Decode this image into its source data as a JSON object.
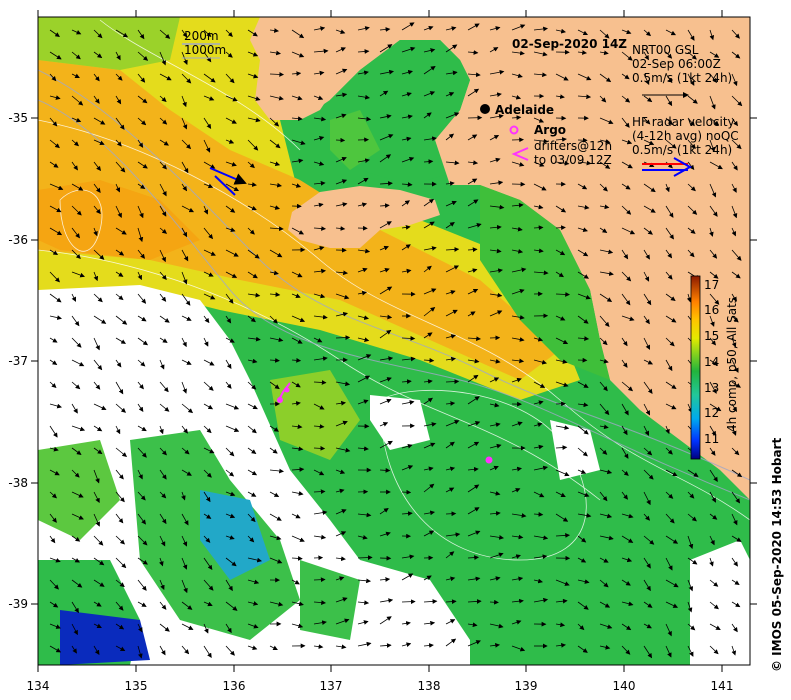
{
  "map": {
    "title": "02-Sep-2020 14Z",
    "city": "Adelaide",
    "legend_argo": "Argo",
    "legend_drifters_line1": "drifters@12h",
    "legend_drifters_line2": "to 03/09 12Z",
    "isobath_200": "200m",
    "isobath_1000": "1000m",
    "gsl_line1": "NRT00 GSL",
    "gsl_line2": "02-Sep 06:00Z",
    "gsl_line3": "0.5m/s (1kt 24h)",
    "hf_line1": "HF radar velocity",
    "hf_line2": "(4-12h avg) noQC",
    "hf_line3": "0.5m/s (1kt 24h)",
    "colorbar_label": "4h comp, p50, All Sats",
    "colorbar_ticks": [
      "11",
      "12",
      "13",
      "14",
      "15",
      "16",
      "17"
    ],
    "credit": "© IMOS 05-Sep-2020 14:53 Hobart",
    "x_ticks": [
      "134",
      "135",
      "136",
      "137",
      "138",
      "139",
      "140",
      "141"
    ],
    "y_ticks": [
      "-35",
      "-36",
      "-37",
      "-38",
      "-39"
    ],
    "colors": {
      "land": "#f7c08f",
      "argo": "#ff33ff",
      "gsl_arrow": "#000000",
      "hf_red": "#ff0000",
      "hf_blue": "#0000ff"
    }
  }
}
